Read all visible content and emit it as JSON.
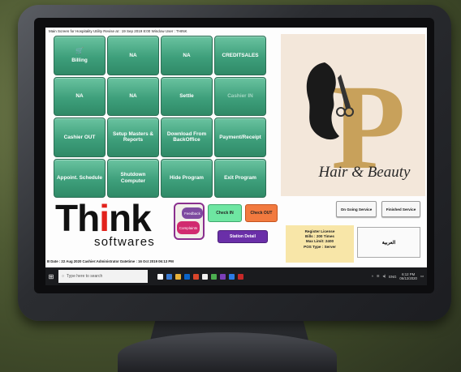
{
  "window": {
    "title": "Main Screen for Hospitality Utility Revise at : 19 Sep 2019 8:00 Window User : THINK"
  },
  "tiles": [
    {
      "label": "Billing",
      "icon": "cart-icon",
      "disabled": false
    },
    {
      "label": "NA",
      "disabled": false
    },
    {
      "label": "NA",
      "disabled": false
    },
    {
      "label": "CREDITSALES",
      "disabled": false
    },
    {
      "label": "NA",
      "disabled": false
    },
    {
      "label": "NA",
      "disabled": false
    },
    {
      "label": "Settle",
      "disabled": false
    },
    {
      "label": "Cashier IN",
      "disabled": true
    },
    {
      "label": "Cashier OUT",
      "disabled": false
    },
    {
      "label": "Setup Masters & Reports",
      "disabled": false
    },
    {
      "label": "Download From BackOffice",
      "disabled": false
    },
    {
      "label": "Payment/Receipt",
      "disabled": false
    },
    {
      "label": "Appoint. Schedule",
      "disabled": false
    },
    {
      "label": "Shutdown Computer",
      "disabled": false
    },
    {
      "label": "Hide Program",
      "disabled": false
    },
    {
      "label": "Exit Program",
      "disabled": false
    }
  ],
  "logo": {
    "think_prefix": "Th",
    "think_red": "i",
    "think_suffix": "nk",
    "softwares": "softwares"
  },
  "feedback": {
    "label_top": "Feedback",
    "label_bottom": "Complaints"
  },
  "actions": {
    "check_in": "Check IN",
    "check_out": "Check OUT",
    "station_detail": "Station Detail"
  },
  "status_line": "B Date : 22 Aug 2020 Cashier:Administrator Datetime : 16 Oct 2019 06:13 PM",
  "brand": {
    "script_text": "Hair & Beauty",
    "letter": "P"
  },
  "services": {
    "ongoing": "On Going Service",
    "finished": "Finished Service"
  },
  "license": {
    "line1": "Register License",
    "line2": "Bills : 200 Times",
    "line3": "Max Limit: 2400",
    "line4": "POS Type : Server"
  },
  "arabic_button": "العربية",
  "taskbar": {
    "search_placeholder": "Type here to search",
    "lang": "ENG",
    "time": "6:12 PM",
    "date": "06/12/2020"
  },
  "colors": {
    "tile_green": "#3e9f7b",
    "check_in": "#6ee6a2",
    "check_out": "#f27a3f",
    "station": "#6a2fa8",
    "brand_gold": "#c8a15b"
  }
}
